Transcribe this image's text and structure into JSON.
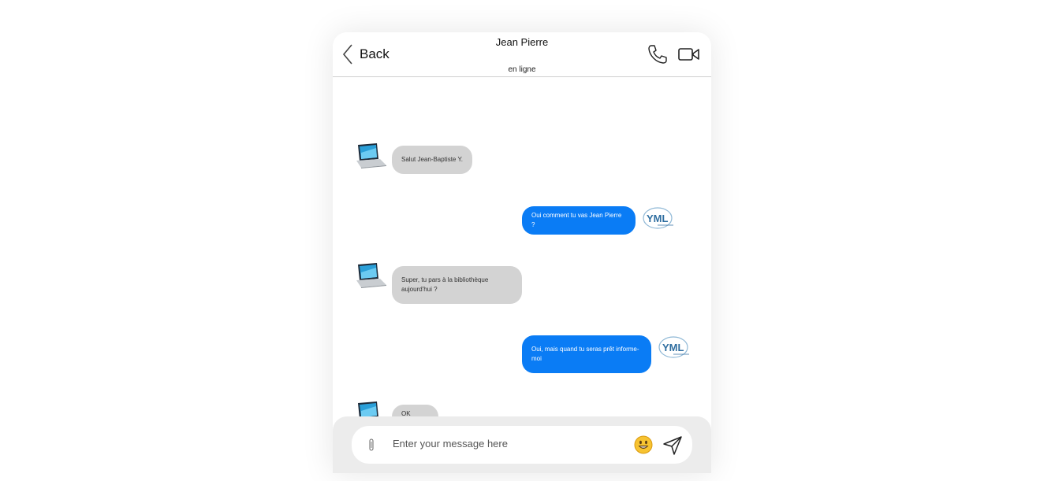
{
  "header": {
    "back_label": "Back",
    "contact_name": "Jean Pierre",
    "status": "en ligne"
  },
  "messages": [
    {
      "direction": "in",
      "text": "Salut Jean-Baptiste Y.",
      "avatar": "laptop-avatar"
    },
    {
      "direction": "out",
      "text": "Oui comment tu vas Jean Pierre ?",
      "avatar": "yml-logo-avatar"
    },
    {
      "direction": "in",
      "text": "Super, tu pars à la bibliothèque aujourd'hui ?",
      "avatar": "laptop-avatar"
    },
    {
      "direction": "out",
      "text": "Oui, mais quand tu seras prêt informe-moi",
      "avatar": "yml-logo-avatar"
    },
    {
      "direction": "in",
      "text": "OK CHEF",
      "avatar": "laptop-avatar"
    }
  ],
  "composer": {
    "placeholder": "Enter your message here",
    "value": ""
  },
  "icons": {
    "back": "chevron-left-icon",
    "call": "phone-icon",
    "video": "video-camera-icon",
    "attach": "paperclip-icon",
    "emoji": "smiley-emoji-icon",
    "send": "paper-plane-send-icon"
  },
  "colors": {
    "outgoing_bubble": "#0a7cf5",
    "incoming_bubble": "#d3d3d3",
    "composer_bar": "#ececec"
  }
}
